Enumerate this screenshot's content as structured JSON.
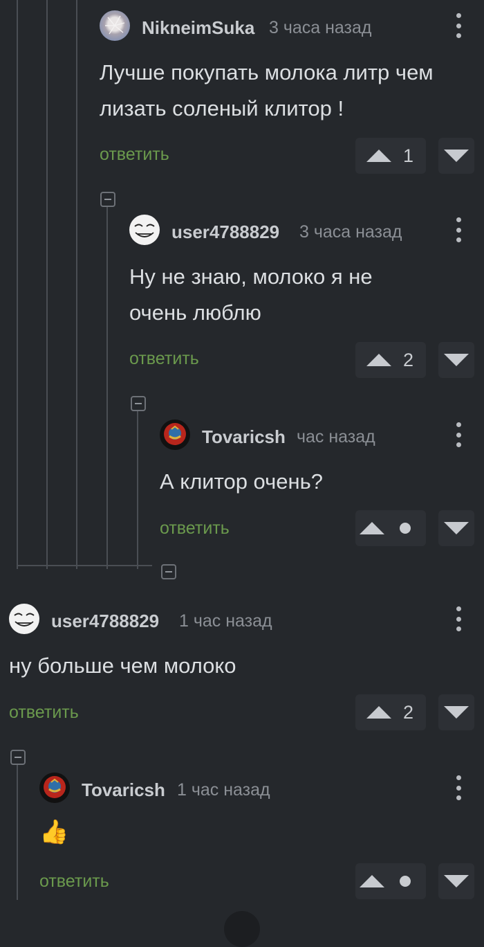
{
  "comments": [
    {
      "username": "NikneimSuka",
      "time": "3 часа назад",
      "text": "Лучше покупать молока литр чем лизать соленый клитор !",
      "reply_label": "ответить",
      "rating": "1",
      "avatar_icon": "dandelion-avatar"
    },
    {
      "username": "user4788829",
      "time": "3 часа назад",
      "text": "Ну не знаю, молоко я не очень люблю",
      "reply_label": "ответить",
      "rating": "2",
      "avatar_icon": "troll-face-avatar"
    },
    {
      "username": "Tovaricsh",
      "time": "час назад",
      "text": "А клитор очень?",
      "reply_label": "ответить",
      "rating": "",
      "avatar_icon": "ussr-emblem-avatar"
    },
    {
      "username": "user4788829",
      "time": "1 час назад",
      "text": "ну больше чем молоко",
      "reply_label": "ответить",
      "rating": "2",
      "avatar_icon": "troll-face-avatar"
    },
    {
      "username": "Tovaricsh",
      "time": "1 час назад",
      "text": "👍",
      "reply_label": "ответить",
      "rating": "",
      "avatar_icon": "ussr-emblem-avatar"
    }
  ],
  "colors": {
    "background": "#25282c",
    "reply_link": "#6b9a4d",
    "thread_line": "#4a4e54",
    "vote_box": "#2d3035"
  }
}
